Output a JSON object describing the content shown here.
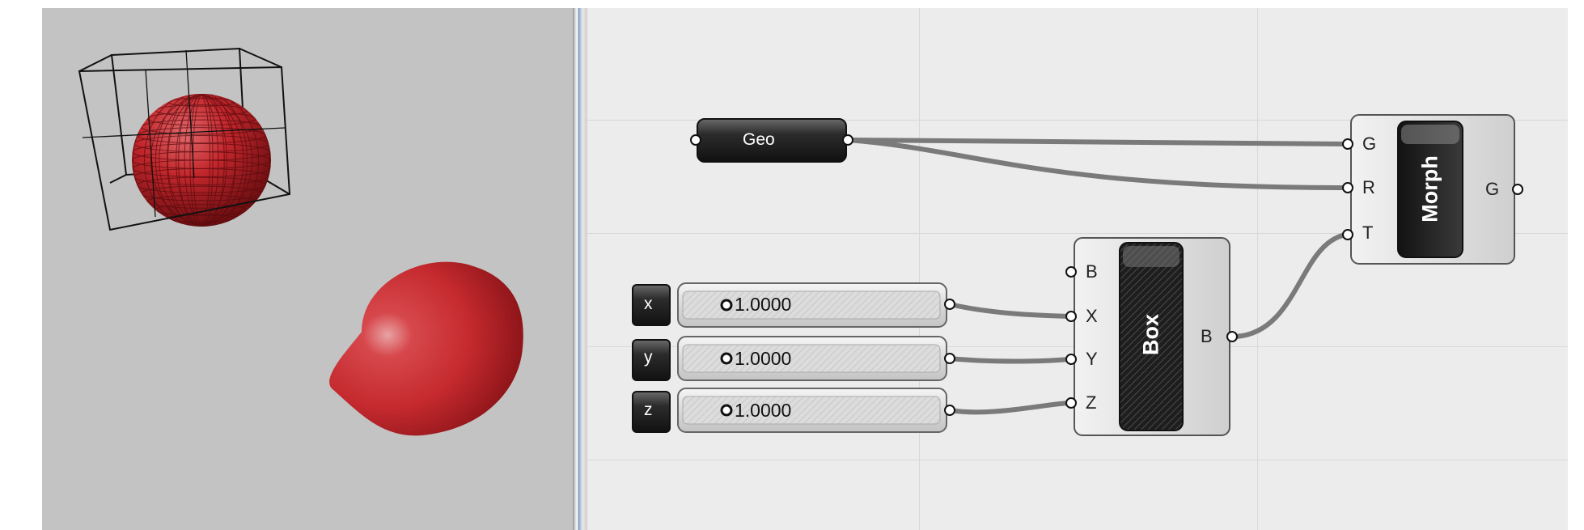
{
  "viewport": {
    "objects": [
      "wireframe-box",
      "mesh-sphere",
      "morphed-sphere"
    ],
    "accent_color": "#c0262b"
  },
  "canvas": {
    "geo_param": {
      "label": "Geo"
    },
    "sliders": [
      {
        "name": "x",
        "value": "1.0000"
      },
      {
        "name": "y",
        "value": "1.0000"
      },
      {
        "name": "z",
        "value": "1.0000"
      }
    ],
    "box_component": {
      "title": "Box",
      "inputs": [
        "B",
        "X",
        "Y",
        "Z"
      ],
      "outputs": [
        "B"
      ]
    },
    "morph_component": {
      "title": "Morph",
      "inputs": [
        "G",
        "R",
        "T"
      ],
      "outputs": [
        "G"
      ]
    }
  }
}
